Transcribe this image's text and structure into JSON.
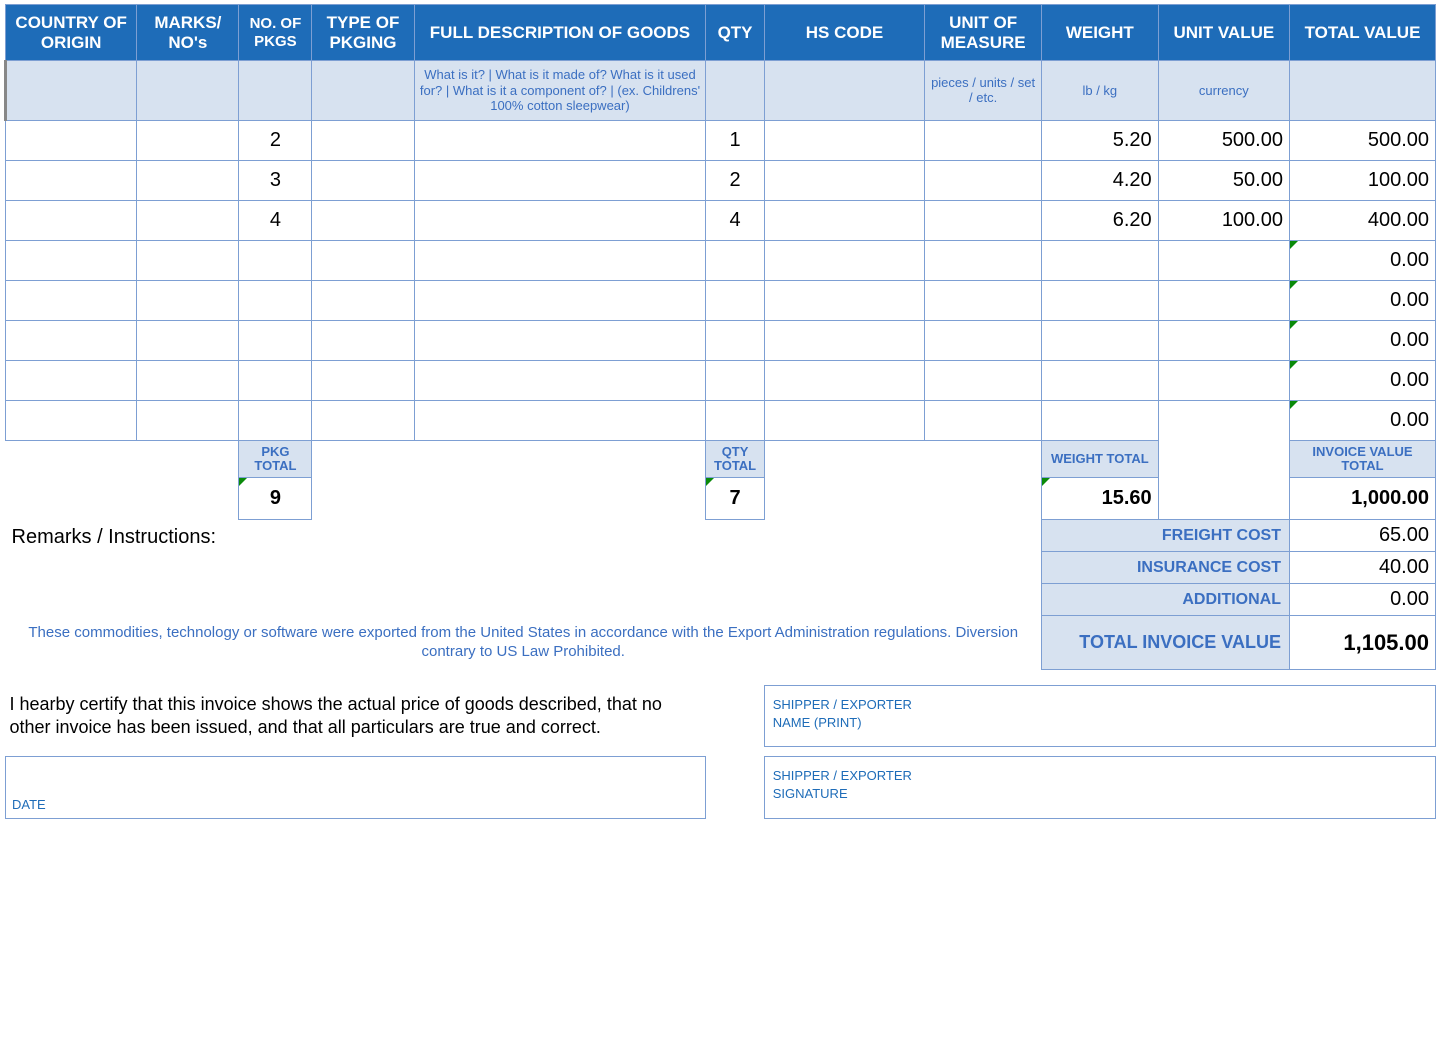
{
  "headers": {
    "country": "COUNTRY OF ORIGIN",
    "marks": "MARKS/ NO's",
    "pkgs": "NO. OF PKGS",
    "pkging": "TYPE OF PKGING",
    "desc": "FULL DESCRIPTION OF GOODS",
    "qty": "QTY",
    "hs": "HS CODE",
    "uom": "UNIT OF MEASURE",
    "weight": "WEIGHT",
    "unitval": "UNIT VALUE",
    "totalval": "TOTAL VALUE"
  },
  "hints": {
    "desc": "What is it? | What is it made of? What is it used for? | What is it a component of? | (ex. Childrens' 100% cotton sleepwear)",
    "uom": "pieces / units / set / etc.",
    "weight": "lb / kg",
    "unitval": "currency"
  },
  "rows": [
    {
      "pkgs": "2",
      "qty": "1",
      "weight": "5.20",
      "unitval": "500.00",
      "totalval": "500.00"
    },
    {
      "pkgs": "3",
      "qty": "2",
      "weight": "4.20",
      "unitval": "50.00",
      "totalval": "100.00"
    },
    {
      "pkgs": "4",
      "qty": "4",
      "weight": "6.20",
      "unitval": "100.00",
      "totalval": "400.00"
    },
    {
      "totalval": "0.00"
    },
    {
      "totalval": "0.00"
    },
    {
      "totalval": "0.00"
    },
    {
      "totalval": "0.00"
    },
    {
      "totalval": "0.00"
    }
  ],
  "totals_labels": {
    "pkg": "PKG TOTAL",
    "qty": "QTY TOTAL",
    "weight": "WEIGHT TOTAL",
    "invoice": "INVOICE VALUE TOTAL"
  },
  "totals": {
    "pkg": "9",
    "qty": "7",
    "weight": "15.60",
    "invoice": "1,000.00"
  },
  "remarks_label": "Remarks / Instructions:",
  "cost_labels": {
    "freight": "FREIGHT COST",
    "insurance": "INSURANCE COST",
    "additional": "ADDITIONAL",
    "total": "TOTAL INVOICE VALUE"
  },
  "costs": {
    "freight": "65.00",
    "insurance": "40.00",
    "additional": "0.00",
    "total": "1,105.00"
  },
  "export_note": "These commodities, technology or software were exported from the United States in accordance with the Export Administration regulations.  Diversion contrary to US Law Prohibited.",
  "certification": "I hearby certify that this invoice shows the actual price of goods described, that no other invoice has been issued, and that all particulars are true and correct.",
  "sig": {
    "name1": "SHIPPER / EXPORTER",
    "name2": "NAME (PRINT)",
    "sig1": "SHIPPER / EXPORTER",
    "sig2": "SIGNATURE",
    "date": "DATE"
  }
}
